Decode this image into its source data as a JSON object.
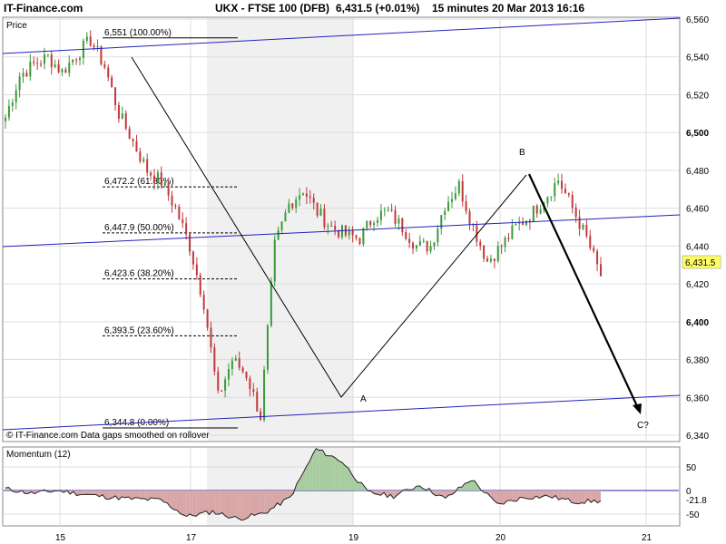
{
  "header": {
    "brand": "IT-Finance.com",
    "instrument": "UKX - FTSE 100 (DFB)",
    "quote": "6,431.5 (+0.01%)",
    "interval": "15 minutes",
    "timestamp": "20 Mar 2013 16:16"
  },
  "price_panel": {
    "label": "Price",
    "footer_note": "© IT-Finance.com  Data gaps smoothed on rollover",
    "last_price_tag": "6,431.5",
    "y_ticks": [
      "6,560",
      "6,540",
      "6,520",
      "6,500",
      "6,480",
      "6,460",
      "6,440",
      "6,420",
      "6,400",
      "6,380",
      "6,360",
      "6,340"
    ]
  },
  "momentum_panel": {
    "label": "Momentum (12)",
    "value_tag": "-21.8",
    "y_ticks": [
      "50",
      "0",
      "-50"
    ]
  },
  "x_ticks": [
    "15",
    "17",
    "19",
    "20",
    "21"
  ],
  "colors": {
    "up_candle": "#3a9a3a",
    "down_candle": "#c0393b",
    "channel_line": "#2222bb",
    "momentum_pos_fill": "#a8cca0",
    "momentum_neg_fill": "#d8a6a6",
    "price_tag_bg": "#ffff66"
  },
  "chart_data": [
    {
      "type": "line",
      "title": "UKX - FTSE 100 (DFB)",
      "ylim": [
        6334,
        6564
      ],
      "x": [
        "15",
        "15",
        "15",
        "15",
        "15",
        "15",
        "16",
        "16",
        "16",
        "16",
        "16",
        "16",
        "17",
        "17",
        "17",
        "17",
        "17",
        "17",
        "17",
        "18",
        "18",
        "18",
        "18",
        "18",
        "18",
        "18",
        "19",
        "19",
        "19",
        "19",
        "19",
        "19",
        "19",
        "19",
        "19",
        "19",
        "19",
        "20",
        "20",
        "20",
        "20",
        "20",
        "20"
      ],
      "series": [
        {
          "values": [
            6508,
            6530,
            6536,
            6540,
            6532,
            6541,
            6549,
            6535,
            6510,
            6495,
            6480,
            6474,
            6460,
            6440,
            6410,
            6360,
            6380,
            6372,
            6350,
            6440,
            6462,
            6470,
            6458,
            6450,
            6446,
            6444,
            6456,
            6458,
            6450,
            6440,
            6440,
            6462,
            6472,
            6450,
            6432,
            6440,
            6450,
            6456,
            6465,
            6475,
            6460,
            6444,
            6424
          ]
        }
      ],
      "fibonacci_levels": [
        {
          "label": "6,551 (100.00%)",
          "value": 6551
        },
        {
          "label": "6,472.2 (61.80%)",
          "value": 6472.2
        },
        {
          "label": "6,447.9 (50.00%)",
          "value": 6447.9
        },
        {
          "label": "6,423.6 (38.20%)",
          "value": 6423.6
        },
        {
          "label": "6,393.5 (23.60%)",
          "value": 6393.5
        },
        {
          "label": "6,344.8 (0.00%)",
          "value": 6344.8
        }
      ],
      "wave_labels": [
        "A",
        "B",
        "C?"
      ]
    },
    {
      "type": "area",
      "title": "Momentum (12)",
      "ylim": [
        -60,
        90
      ],
      "x": [
        "15",
        "15",
        "15",
        "16",
        "16",
        "17",
        "17",
        "17",
        "17",
        "17",
        "18",
        "18",
        "18",
        "18",
        "19",
        "19",
        "19",
        "19",
        "20",
        "20",
        "20",
        "20",
        "20",
        "20"
      ],
      "series": [
        {
          "values": [
            4,
            -6,
            0,
            -8,
            -14,
            -18,
            -20,
            -55,
            -45,
            -60,
            -48,
            -15,
            88,
            62,
            -4,
            -12,
            12,
            -18,
            24,
            -30,
            -15,
            -12,
            -24,
            -22
          ]
        }
      ]
    }
  ]
}
